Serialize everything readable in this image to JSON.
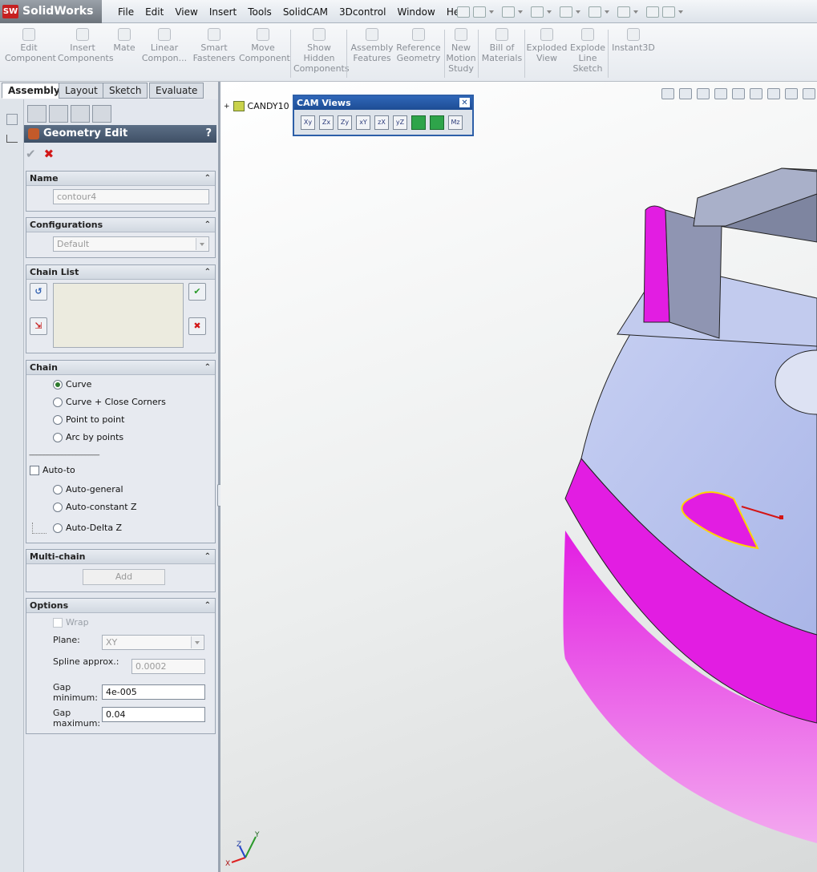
{
  "app": {
    "logo_badge": "SW",
    "logo_text": "SolidWorks"
  },
  "menu": [
    "File",
    "Edit",
    "View",
    "Insert",
    "Tools",
    "SolidCAM",
    "3Dcontrol",
    "Window",
    "Help"
  ],
  "command_manager": [
    {
      "line1": "Edit",
      "line2": "Component"
    },
    {
      "line1": "Insert",
      "line2": "Components"
    },
    {
      "line1": "Mate",
      "line2": ""
    },
    {
      "line1": "Linear",
      "line2": "Compon..."
    },
    {
      "line1": "Smart",
      "line2": "Fasteners"
    },
    {
      "line1": "Move",
      "line2": "Component"
    },
    {
      "line1": "Show",
      "line2": "Hidden",
      "line3": "Components"
    },
    {
      "line1": "Assembly",
      "line2": "Features"
    },
    {
      "line1": "Reference",
      "line2": "Geometry"
    },
    {
      "line1": "New",
      "line2": "Motion",
      "line3": "Study"
    },
    {
      "line1": "Bill of",
      "line2": "Materials"
    },
    {
      "line1": "Exploded",
      "line2": "View"
    },
    {
      "line1": "Explode",
      "line2": "Line",
      "line3": "Sketch"
    },
    {
      "line1": "Instant3D",
      "line2": ""
    }
  ],
  "tabs": [
    "Assembly",
    "Layout",
    "Sketch",
    "Evaluate"
  ],
  "property_manager": {
    "title": "Geometry Edit",
    "help": "?",
    "name_group": {
      "header": "Name",
      "value": "contour4"
    },
    "config_group": {
      "header": "Configurations",
      "value": "Default"
    },
    "chain_list_group": {
      "header": "Chain List"
    },
    "chain_group": {
      "header": "Chain",
      "options": [
        "Curve",
        "Curve + Close Corners",
        "Point to point",
        "Arc by points"
      ],
      "selected": "Curve",
      "separator": "---------------------------------------",
      "auto_to": "Auto-to",
      "auto_options": [
        "Auto-general",
        "Auto-constant Z",
        "Auto-Delta Z"
      ]
    },
    "multichain_group": {
      "header": "Multi-chain",
      "add_label": "Add"
    },
    "options_group": {
      "header": "Options",
      "wrap": "Wrap",
      "plane_label": "Plane:",
      "plane_value": "XY",
      "spline_label": "Spline approx.:",
      "spline_value": "0.0002",
      "gap_min_label_1": "Gap",
      "gap_min_label_2": "minimum:",
      "gap_min_value": "4e-005",
      "gap_max_label_1": "Gap",
      "gap_max_label_2": "maximum:",
      "gap_max_value": "0.04"
    }
  },
  "viewport": {
    "tree_root": "CANDY10",
    "cam_views": {
      "title": "CAM Views",
      "buttons": [
        "Xy",
        "Zx",
        "Zy",
        "xY",
        "zX",
        "yZ",
        "iso",
        "dim",
        "Mz"
      ]
    },
    "triad": {
      "x": "X",
      "y": "Y",
      "z": "Z"
    }
  },
  "colors": {
    "magenta": "#e21de2",
    "face": "#b8c2ec",
    "wall": "#8a90a8",
    "title_blue": "#2f66b8"
  }
}
